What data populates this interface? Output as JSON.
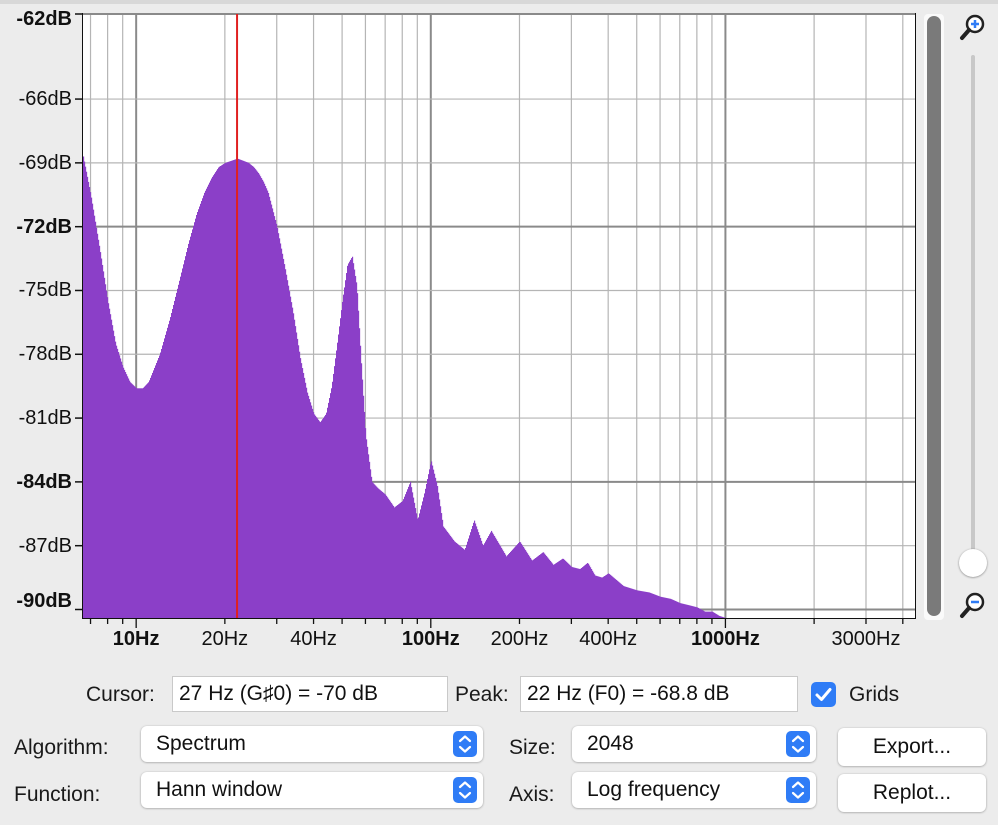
{
  "chart_data": {
    "type": "area",
    "x": [
      6.6,
      7,
      7.5,
      8,
      8.5,
      9,
      9.5,
      10,
      10.5,
      11,
      12,
      13,
      14,
      15,
      16,
      17,
      18,
      19,
      20,
      21,
      22,
      23,
      24,
      25,
      26,
      27,
      28,
      30,
      32,
      34,
      36,
      38,
      40,
      42,
      44,
      46,
      48,
      50,
      52,
      54,
      56,
      58,
      60,
      63,
      66,
      70,
      75,
      80,
      85,
      90,
      95,
      100,
      105,
      110,
      120,
      130,
      140,
      150,
      160,
      180,
      200,
      220,
      240,
      260,
      280,
      300,
      320,
      340,
      360,
      380,
      400,
      450,
      500,
      550,
      600,
      650,
      700,
      750,
      800,
      850,
      900,
      950,
      1000,
      1100,
      1200,
      1300,
      1400,
      1500,
      1600,
      1700,
      1800
    ],
    "values": [
      -68.7,
      -70.5,
      -73,
      -75.5,
      -77.5,
      -78.6,
      -79.3,
      -79.6,
      -79.6,
      -79.3,
      -78,
      -76.3,
      -74.5,
      -72.8,
      -71.4,
      -70.4,
      -69.7,
      -69.2,
      -69,
      -68.9,
      -68.8,
      -68.9,
      -69,
      -69.2,
      -69.5,
      -69.9,
      -70.4,
      -72,
      -74,
      -76,
      -78.2,
      -79.8,
      -80.8,
      -81.2,
      -80.8,
      -79.5,
      -77.5,
      -75.5,
      -73.8,
      -73.4,
      -74.8,
      -78.5,
      -81.8,
      -84,
      -84.3,
      -84.6,
      -85.2,
      -84.9,
      -84,
      -85.8,
      -84.5,
      -83,
      -84.2,
      -86.1,
      -86.8,
      -87.2,
      -85.8,
      -87,
      -86.3,
      -87.5,
      -86.8,
      -87.7,
      -87.3,
      -87.9,
      -87.6,
      -88,
      -88.1,
      -87.8,
      -88.4,
      -88.5,
      -88.3,
      -88.9,
      -89.1,
      -89.2,
      -89.4,
      -89.5,
      -89.7,
      -89.8,
      -89.9,
      -90.1,
      -90.1,
      -90.3,
      -90.4,
      -90.6,
      -90.7,
      -90.8,
      -90.9,
      -91,
      -91.1,
      -91.2,
      -91.3
    ],
    "xscale": "log",
    "xlim": [
      6.6,
      4400
    ],
    "ylim": [
      -90.4,
      -62
    ],
    "grid": true,
    "cursor_hz": 22,
    "fill_color": "#8b3fc8",
    "cursor_color": "#e02020",
    "yticks": [
      {
        "v": -62,
        "label": "-62dB",
        "bold": true
      },
      {
        "v": -66,
        "label": "-66dB",
        "bold": false
      },
      {
        "v": -69,
        "label": "-69dB",
        "bold": false
      },
      {
        "v": -72,
        "label": "-72dB",
        "bold": true
      },
      {
        "v": -75,
        "label": "-75dB",
        "bold": false
      },
      {
        "v": -78,
        "label": "-78dB",
        "bold": false
      },
      {
        "v": -81,
        "label": "-81dB",
        "bold": false
      },
      {
        "v": -84,
        "label": "-84dB",
        "bold": true
      },
      {
        "v": -87,
        "label": "-87dB",
        "bold": false
      },
      {
        "v": -90,
        "label": "-90dB",
        "bold": true
      }
    ],
    "xticks": [
      {
        "v": 10,
        "label": "10Hz",
        "bold": true
      },
      {
        "v": 20,
        "label": "20Hz",
        "bold": false
      },
      {
        "v": 40,
        "label": "40Hz",
        "bold": false
      },
      {
        "v": 100,
        "label": "100Hz",
        "bold": true
      },
      {
        "v": 200,
        "label": "200Hz",
        "bold": false
      },
      {
        "v": 400,
        "label": "400Hz",
        "bold": false
      },
      {
        "v": 1000,
        "label": "1000Hz",
        "bold": true
      },
      {
        "v": 3000,
        "label": "3000Hz",
        "bold": false
      }
    ]
  },
  "readout": {
    "cursor_label": "Cursor:",
    "cursor_value": "27 Hz (G♯0) = -70 dB",
    "peak_label": "Peak:",
    "peak_value": "22 Hz (F0) = -68.8 dB",
    "grids_label": "Grids",
    "grids_checked": true
  },
  "controls": {
    "algorithm_label": "Algorithm:",
    "algorithm_value": "Spectrum",
    "function_label": "Function:",
    "function_value": "Hann window",
    "size_label": "Size:",
    "size_value": "2048",
    "axis_label": "Axis:",
    "axis_value": "Log frequency",
    "export_label": "Export...",
    "replot_label": "Replot..."
  },
  "icons": {
    "zoom_in": "zoom-in-icon",
    "zoom_out": "zoom-out-icon",
    "select_arrows": "chevron-up-down-icon",
    "checkmark": "checkmark-icon"
  },
  "colors": {
    "accent": "#2f7cf6"
  }
}
